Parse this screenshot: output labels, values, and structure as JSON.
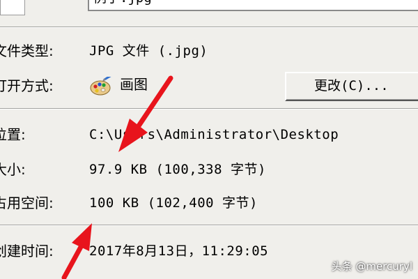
{
  "header": {
    "filename_partial": "例子.jpg"
  },
  "properties": {
    "file_type_label": "文件类型:",
    "file_type_value": "JPG 文件 (.jpg)",
    "opens_with_label": "打开方式:",
    "opens_with_app": "画图",
    "change_button_label": "更改(C)...",
    "location_label": "位置:",
    "location_value": "C:\\Users\\Administrator\\Desktop",
    "size_label": "大小:",
    "size_value": "97.9 KB (100,338 字节)",
    "size_on_disk_label": "占用空间:",
    "size_on_disk_value": "100 KB (102,400 字节)",
    "created_label": "创建时间:",
    "created_value": "2017年8月13日，11:29:05"
  },
  "annotations": {
    "arrow_color": "#e8141c"
  },
  "watermark": {
    "text": "头条 @mercuryl"
  },
  "icons": {
    "file": "file-icon",
    "paint_app": "paint-palette-icon"
  }
}
